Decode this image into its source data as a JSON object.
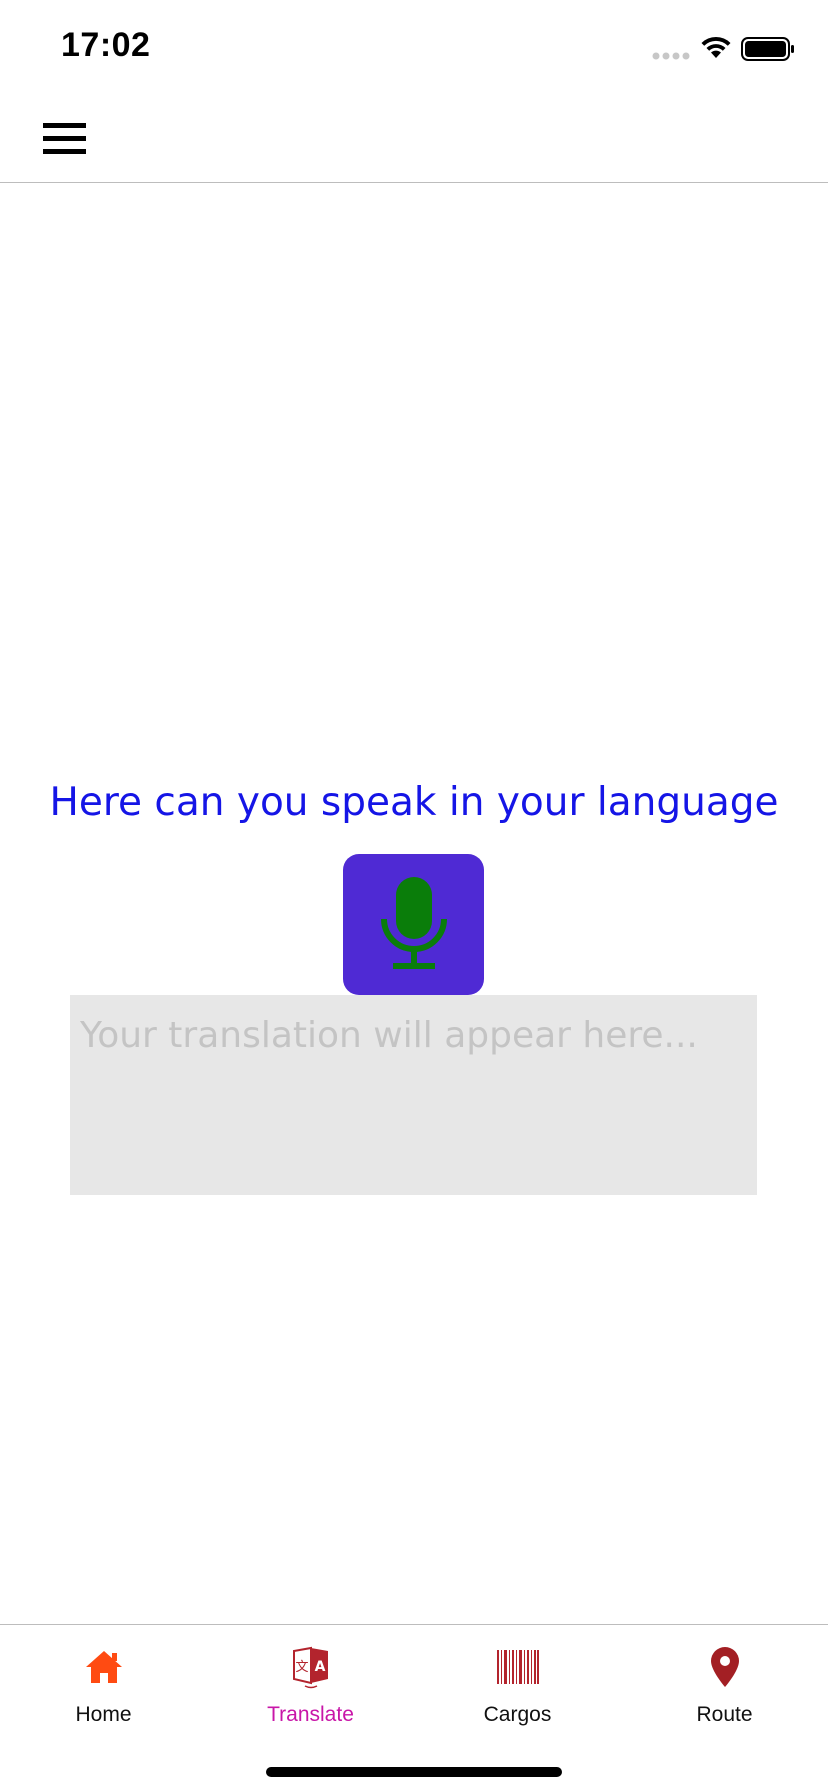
{
  "status_bar": {
    "time": "17:02",
    "icons": [
      "signal-dots-icon",
      "wifi-icon",
      "battery-icon"
    ]
  },
  "nav": {
    "menu_icon": "hamburger-menu-icon"
  },
  "main": {
    "prompt": "Here can you speak in your language",
    "mic_icon": "microphone-icon",
    "translation_placeholder": "Your translation will appear here..."
  },
  "tabs": [
    {
      "label": "Home",
      "icon": "home-icon",
      "active": false
    },
    {
      "label": "Translate",
      "icon": "translate-icon",
      "active": true
    },
    {
      "label": "Cargos",
      "icon": "barcode-icon",
      "active": false
    },
    {
      "label": "Route",
      "icon": "map-pin-icon",
      "active": false
    }
  ],
  "colors": {
    "prompt_text": "#1515e6",
    "mic_button_bg": "#4f2ad4",
    "mic_icon": "#0a7d0a",
    "translation_box_bg": "#e7e7e7",
    "placeholder_text": "#c4c4c4",
    "active_tab_label": "#c816a8",
    "home_icon": "#ff4b12",
    "cargos_icon": "#b3242d",
    "route_icon": "#a31f24"
  }
}
